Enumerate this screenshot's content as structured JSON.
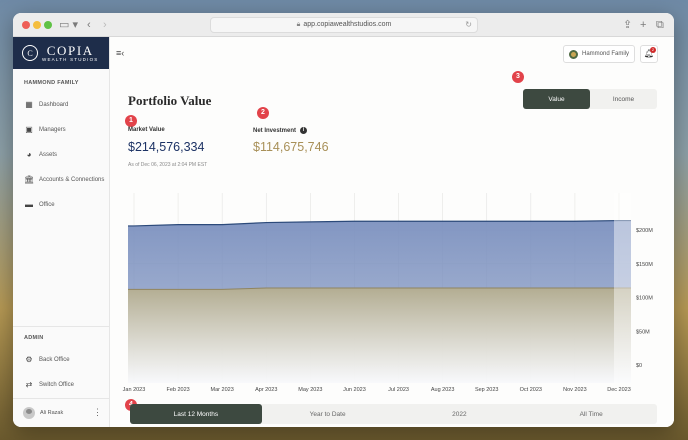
{
  "browser": {
    "url": "app.copiawealthstudios.com"
  },
  "brand": {
    "name": "COPIA",
    "subtitle": "WEALTH STUDIOS",
    "mark": "C"
  },
  "sidebar": {
    "section_label": "HAMMOND FAMILY",
    "items": [
      {
        "label": "Dashboard",
        "icon": "grid-icon"
      },
      {
        "label": "Managers",
        "icon": "contacts-icon"
      },
      {
        "label": "Assets",
        "icon": "pie-icon"
      },
      {
        "label": "Accounts & Connections",
        "icon": "bank-icon"
      },
      {
        "label": "Office",
        "icon": "briefcase-icon"
      }
    ],
    "admin_label": "ADMIN",
    "admin_items": [
      {
        "label": "Back Office",
        "icon": "gear-icon"
      },
      {
        "label": "Switch Office",
        "icon": "switch-icon"
      }
    ],
    "user": {
      "name": "Ali Razak"
    }
  },
  "header": {
    "family_name": "Hammond Family",
    "notification_count": "2"
  },
  "markers": [
    "1",
    "2",
    "3",
    "4"
  ],
  "main": {
    "title": "Portfolio Value",
    "toggle": [
      {
        "label": "Value",
        "active": true
      },
      {
        "label": "Income",
        "active": false
      }
    ],
    "market_value_label": "Market Value",
    "market_value": "$214,576,334",
    "as_of": "As of Dec 06, 2023 at 2:04 PM EST",
    "net_investment_label": "Net Investment",
    "net_investment": "$114,675,746"
  },
  "ranges": [
    {
      "label": "Last 12 Months",
      "active": true
    },
    {
      "label": "Year to Date",
      "active": false
    },
    {
      "label": "2022",
      "active": false
    },
    {
      "label": "All Time",
      "active": false
    }
  ],
  "colors": {
    "market_line": "#2c4a7a",
    "market_fill": "#7c91bf",
    "net_line": "#8f8460",
    "net_fill": "#b3ad92",
    "accent_dark": "#3d4940"
  },
  "chart_data": {
    "type": "area",
    "categories": [
      "Jan 2023",
      "Feb 2023",
      "Mar 2023",
      "Apr 2023",
      "May 2023",
      "Jun 2023",
      "Jul 2023",
      "Aug 2023",
      "Sep 2023",
      "Oct 2023",
      "Nov 2023",
      "Dec 2023"
    ],
    "series": [
      {
        "values": [
          206,
          208,
          208,
          211,
          212,
          213,
          213,
          213,
          213,
          213,
          213,
          214
        ]
      },
      {
        "values": [
          112,
          112,
          112,
          114,
          114,
          114,
          114,
          114,
          114,
          114,
          114,
          114
        ]
      }
    ],
    "ylim": [
      0,
      200
    ],
    "yticks": [
      0,
      50,
      100,
      150,
      200
    ],
    "ytick_labels": [
      "$0",
      "$50M",
      "$100M",
      "$150M",
      "$200M"
    ],
    "grid": true,
    "legend": "none"
  }
}
